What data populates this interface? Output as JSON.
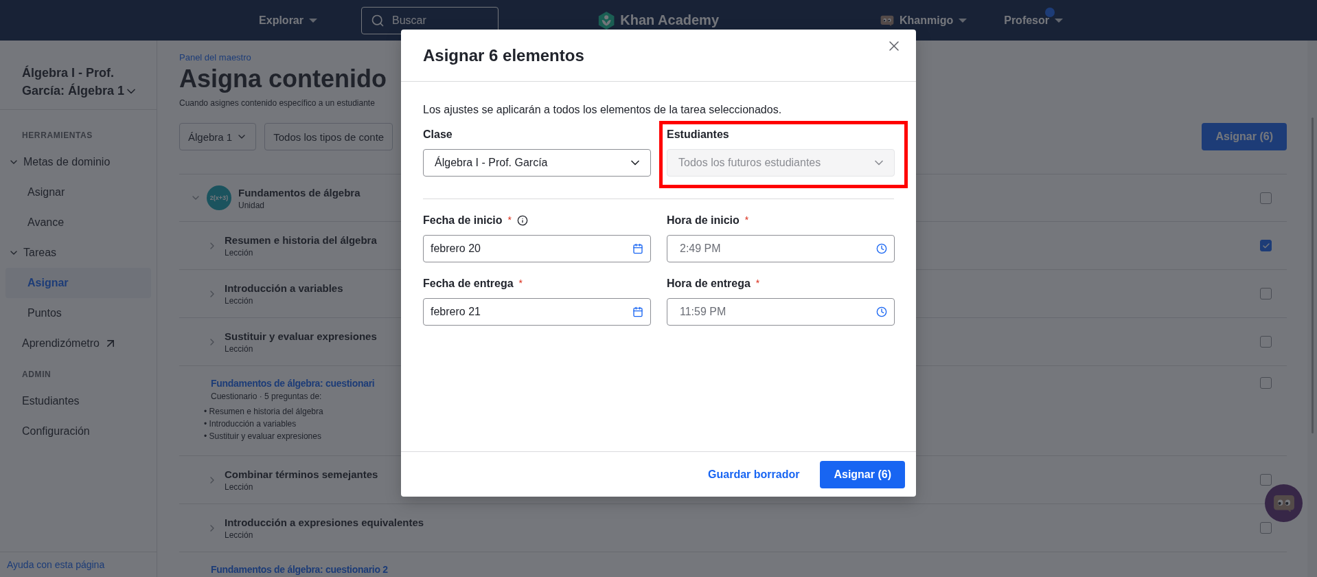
{
  "top_nav": {
    "explore": "Explorar",
    "search": {
      "placeholder": "Buscar"
    },
    "logo": "Khan Academy",
    "khanmigo": "Khanmigo",
    "profile": "Profesor",
    "notification": true
  },
  "sidebar": {
    "class_title": "Álgebra I - Prof. García: Álgebra 1",
    "sections": [
      {
        "heading": "HERRAMIENTAS",
        "items": [
          {
            "label": "Metas de dominio",
            "kind": "group",
            "expanded": true,
            "selected": false,
            "children": [
              {
                "label": "Asignar",
                "selected": false
              },
              {
                "label": "Avance",
                "selected": false
              }
            ]
          },
          {
            "label": "Tareas",
            "kind": "group",
            "expanded": true,
            "selected": false,
            "children": [
              {
                "label": "Asignar",
                "selected": true
              },
              {
                "label": "Puntos",
                "selected": false
              }
            ]
          },
          {
            "label": "Aprendizómetro",
            "kind": "external",
            "selected": false
          }
        ]
      },
      {
        "heading": "ADMIN",
        "items": [
          {
            "label": "Estudiantes",
            "kind": "link",
            "selected": false
          },
          {
            "label": "Configuración",
            "kind": "link",
            "selected": false
          }
        ]
      }
    ],
    "help_link": "Ayuda con esta página"
  },
  "main": {
    "breadcrumb": "Panel del maestro",
    "title": "Asigna contenido",
    "description": "Cuando asignes contenido específico a un estudiante",
    "filters": [
      "Álgebra 1",
      "Todos los tipos de conte"
    ],
    "assign_button": "Asignar (6)",
    "rows": [
      {
        "kind": "unit",
        "title": "Fundamentos de álgebra",
        "subtitle": "Unidad",
        "icon_text": "2(x+3)",
        "expanded": true,
        "checked": false
      },
      {
        "kind": "lesson",
        "title": "Resumen e historia del álgebra",
        "subtitle": "Lección",
        "checked": true
      },
      {
        "kind": "lesson",
        "title": "Introducción a variables",
        "subtitle": "Lección",
        "checked": false
      },
      {
        "kind": "lesson",
        "title": "Sustituir y evaluar expresiones",
        "subtitle": "Lección",
        "checked": false
      },
      {
        "kind": "quiz",
        "title": "Fundamentos de álgebra: cuestionari",
        "subtitle": "Cuestionario · 5 preguntas de:",
        "bullet_marker": "•",
        "bullets": [
          "Resumen e historia del álgebra",
          "Introducción a variables",
          "Sustituir y evaluar expresiones"
        ],
        "checked": false
      },
      {
        "kind": "lesson",
        "title": "Combinar términos semejantes",
        "subtitle": "Lección",
        "checked": false
      },
      {
        "kind": "lesson",
        "title": "Introducción a expresiones equivalentes",
        "subtitle": "Lección",
        "checked": false
      },
      {
        "kind": "quiz",
        "title": "Fundamentos de álgebra: cuestionario 2"
      }
    ]
  },
  "modal": {
    "title": "Asignar 6 elementos",
    "note": "Los ajustes se aplicarán a todos los elementos de la tarea seleccionados.",
    "fields": [
      {
        "label": "Clase",
        "value": "Álgebra I - Prof. García",
        "disabled": false,
        "highlighted": false
      },
      {
        "label": "Estudiantes",
        "value": "Todos los futuros estudiantes",
        "disabled": true,
        "highlighted": true
      }
    ],
    "schedule": [
      {
        "kind": "date",
        "label": "Fecha de inicio",
        "required_mark": "*",
        "info": true,
        "value": "febrero 20"
      },
      {
        "kind": "time",
        "label": "Hora de inicio",
        "required_mark": "*",
        "info": false,
        "value": "2:49 PM"
      },
      {
        "kind": "date",
        "label": "Fecha de entrega",
        "required_mark": "*",
        "info": false,
        "value": "febrero 21"
      },
      {
        "kind": "time",
        "label": "Hora de entrega",
        "required_mark": "*",
        "info": false,
        "value": "11:59 PM"
      }
    ],
    "secondary_button": "Guardar borrador",
    "primary_button": "Asignar (6)"
  }
}
